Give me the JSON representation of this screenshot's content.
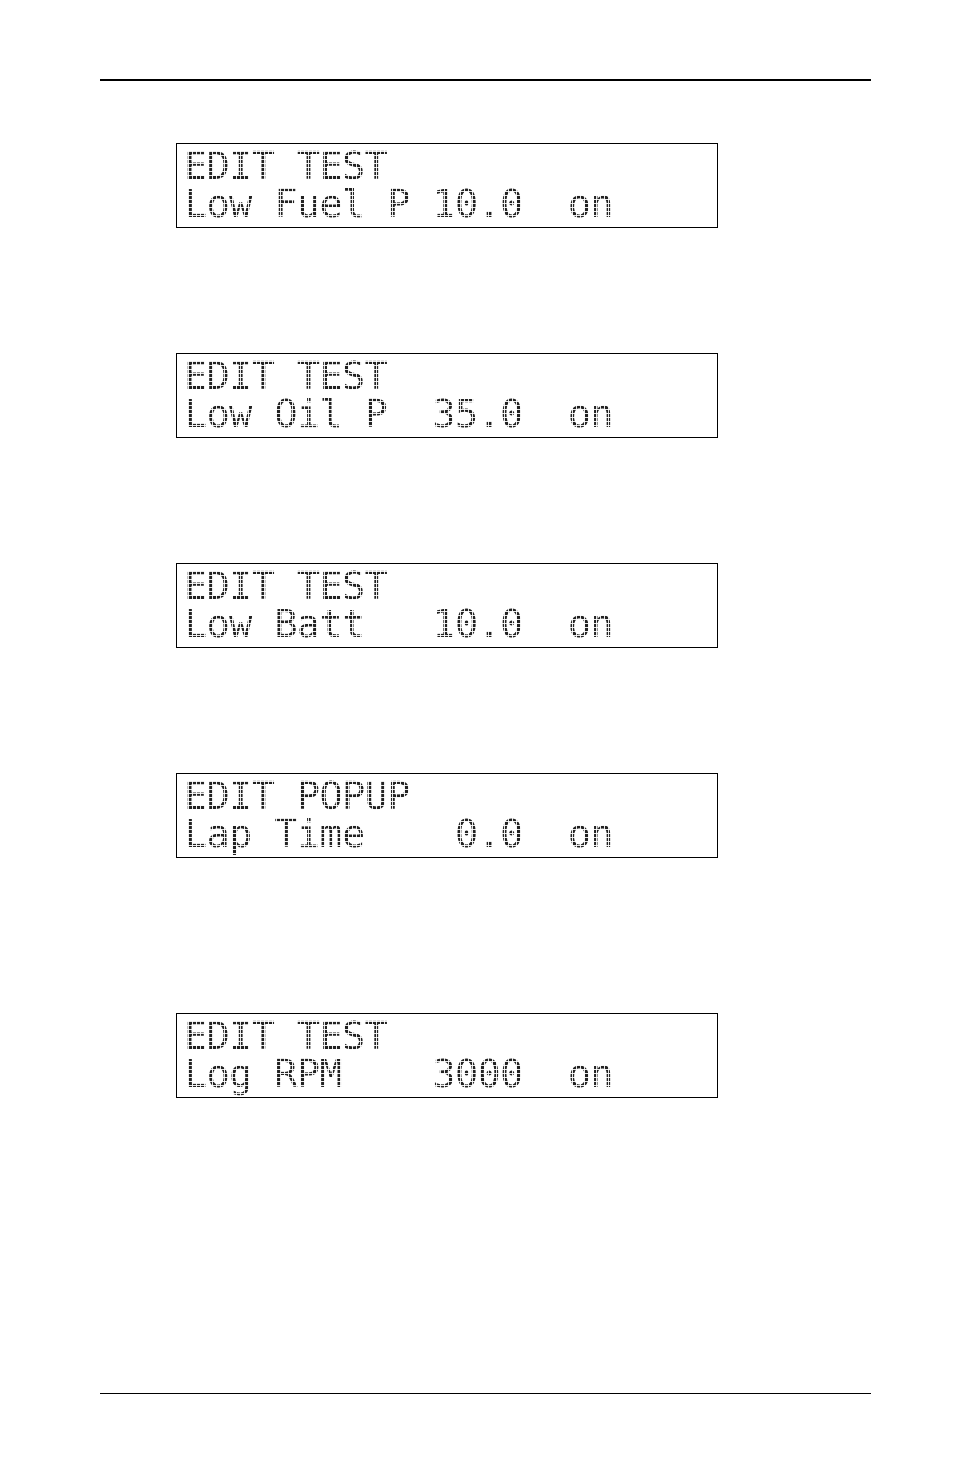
{
  "displays": [
    {
      "line1": "EDIT TEST",
      "line2": "Low Fuel P 10.0  on"
    },
    {
      "line1": "EDIT TEST",
      "line2": "Low Oil P  35.0  on"
    },
    {
      "line1": "EDIT TEST",
      "line2": "Low Batt   10.0  on"
    },
    {
      "line1": "EDIT POPUP",
      "line2": "Lap Time    0.0  on"
    },
    {
      "line1": "EDIT TEST",
      "line2": "Log RPM    3000  on"
    }
  ]
}
